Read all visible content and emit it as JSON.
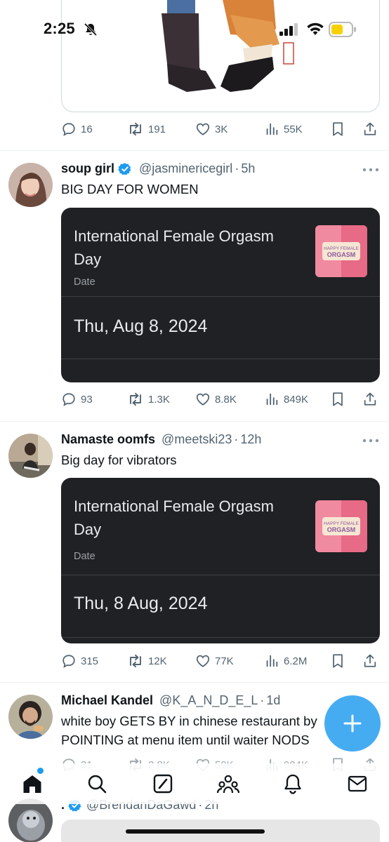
{
  "status_bar": {
    "time": "2:25"
  },
  "colors": {
    "accent": "#1d9bf0",
    "text_primary": "#0f1419",
    "text_secondary": "#536471",
    "card_bg": "#202124",
    "battery_low": "#f7d000"
  },
  "top_tweet": {
    "metrics": {
      "replies": "16",
      "reposts": "191",
      "likes": "3K",
      "views": "55K"
    }
  },
  "tweets": [
    {
      "name": "soup girl",
      "verified": true,
      "handle": "@jasminericegirl",
      "time": "5h",
      "text": "BIG DAY FOR WOMEN",
      "card": {
        "title": "International Female Orgasm Day",
        "type": "Date",
        "date": "Thu, Aug 8, 2024",
        "thumb_text": "HAPPY FEMALE ORGASM"
      },
      "metrics": {
        "replies": "93",
        "reposts": "1.3K",
        "likes": "8.8K",
        "views": "849K"
      }
    },
    {
      "name": "Namaste oomfs",
      "verified": false,
      "handle": "@meetski23",
      "time": "12h",
      "text": "Big day for vibrators",
      "card": {
        "title": "International Female Orgasm Day",
        "type": "Date",
        "date": "Thu, 8 Aug, 2024",
        "thumb_text": "HAPPY FEMALE ORGASM"
      },
      "metrics": {
        "replies": "315",
        "reposts": "12K",
        "likes": "77K",
        "views": "6.2M"
      }
    },
    {
      "name": "Michael Kandel",
      "verified": false,
      "handle": "@K_A_N_D_E_L",
      "time": "1d",
      "text_line1": "white boy GETS BY in chinese restaurant by",
      "text_line2": "POINTING at menu item until waiter NODS",
      "metrics": {
        "replies": "31",
        "reposts": "2.8K",
        "likes": "59K",
        "views": "994K"
      }
    },
    {
      "name": ".",
      "verified": true,
      "handle": "@BrendanDaGawd",
      "time": "2h"
    }
  ],
  "bottom_nav": {
    "items": [
      "home-icon",
      "search-icon",
      "grok-icon",
      "communities-icon",
      "notifications-icon",
      "messages-icon"
    ]
  },
  "fab": {
    "icon": "compose-plus-icon"
  }
}
